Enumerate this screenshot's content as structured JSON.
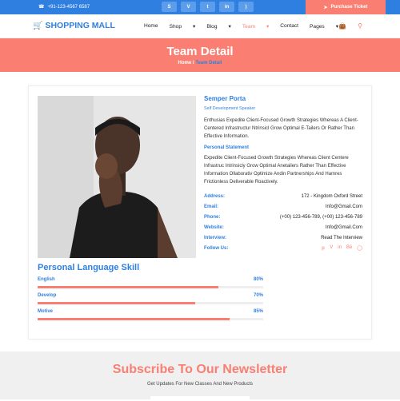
{
  "topbar": {
    "phone": "+91-123-4567 6587",
    "socials": [
      {
        "icon": "skype-icon",
        "glyph": "S"
      },
      {
        "icon": "vimeo-icon",
        "glyph": "V"
      },
      {
        "icon": "twitter-icon",
        "glyph": "t"
      },
      {
        "icon": "linkedin-icon",
        "glyph": "in"
      },
      {
        "icon": "rss-icon",
        "glyph": ")"
      }
    ],
    "ticket_label": "Purchase Ticket"
  },
  "nav": {
    "logo": "SHOPPING MALL",
    "menu": [
      "Home",
      "Shop",
      "Blog",
      "Team",
      "Contact",
      "Pages"
    ],
    "active": "Team"
  },
  "banner": {
    "title": "Team Detail",
    "crumb_home": "Home",
    "crumb_sep": " / ",
    "crumb_current": "Team Detail"
  },
  "member": {
    "name": "Semper Porta",
    "role": "Self Development Speaker",
    "bio": "Enthusias Expedite Client-Focused Growth Strategies Whereas A Client-Centered Infrastructur Ntrinsicl Grow Optimal E-Tailers Or Rather Than Effective Information.",
    "statement_title": "Personal Statement",
    "statement": "Expedite Client-Focused Growth Strategies Whereas Client Centere Infrastruc Intrinsicly Grow Optimal Anetailers Rather Than Effective Information Ollaborativ Optimize Andin Partnerships And Hamres Frictionless Deliverable Roactively.",
    "details": [
      {
        "key": "Address:",
        "value": "172 - Kingdom Oxford Street"
      },
      {
        "key": "Email:",
        "value": "Info@Gmail.Com"
      },
      {
        "key": "Phone:",
        "value": "(+00) 123-456-789, (+00) 123-456-789"
      },
      {
        "key": "Website:",
        "value": "Info@Gmail.Com"
      },
      {
        "key": "Interview:",
        "value": "Read The Interview"
      }
    ],
    "follow_label": "Follow Us:"
  },
  "skills": {
    "title": "Personal Language Skill",
    "items": [
      {
        "name": "English",
        "percent_label": "80%",
        "value": 0.8
      },
      {
        "name": "Develop",
        "percent_label": "70%",
        "value": 0.7
      },
      {
        "name": "Motive",
        "percent_label": "85%",
        "value": 0.85
      }
    ]
  },
  "newsletter": {
    "title": "Subscribe To Our Newsletter",
    "subtitle": "Get Updates For New Classes And New Products"
  },
  "colors": {
    "primary": "#2f7fe0",
    "accent": "#fa7f72"
  }
}
